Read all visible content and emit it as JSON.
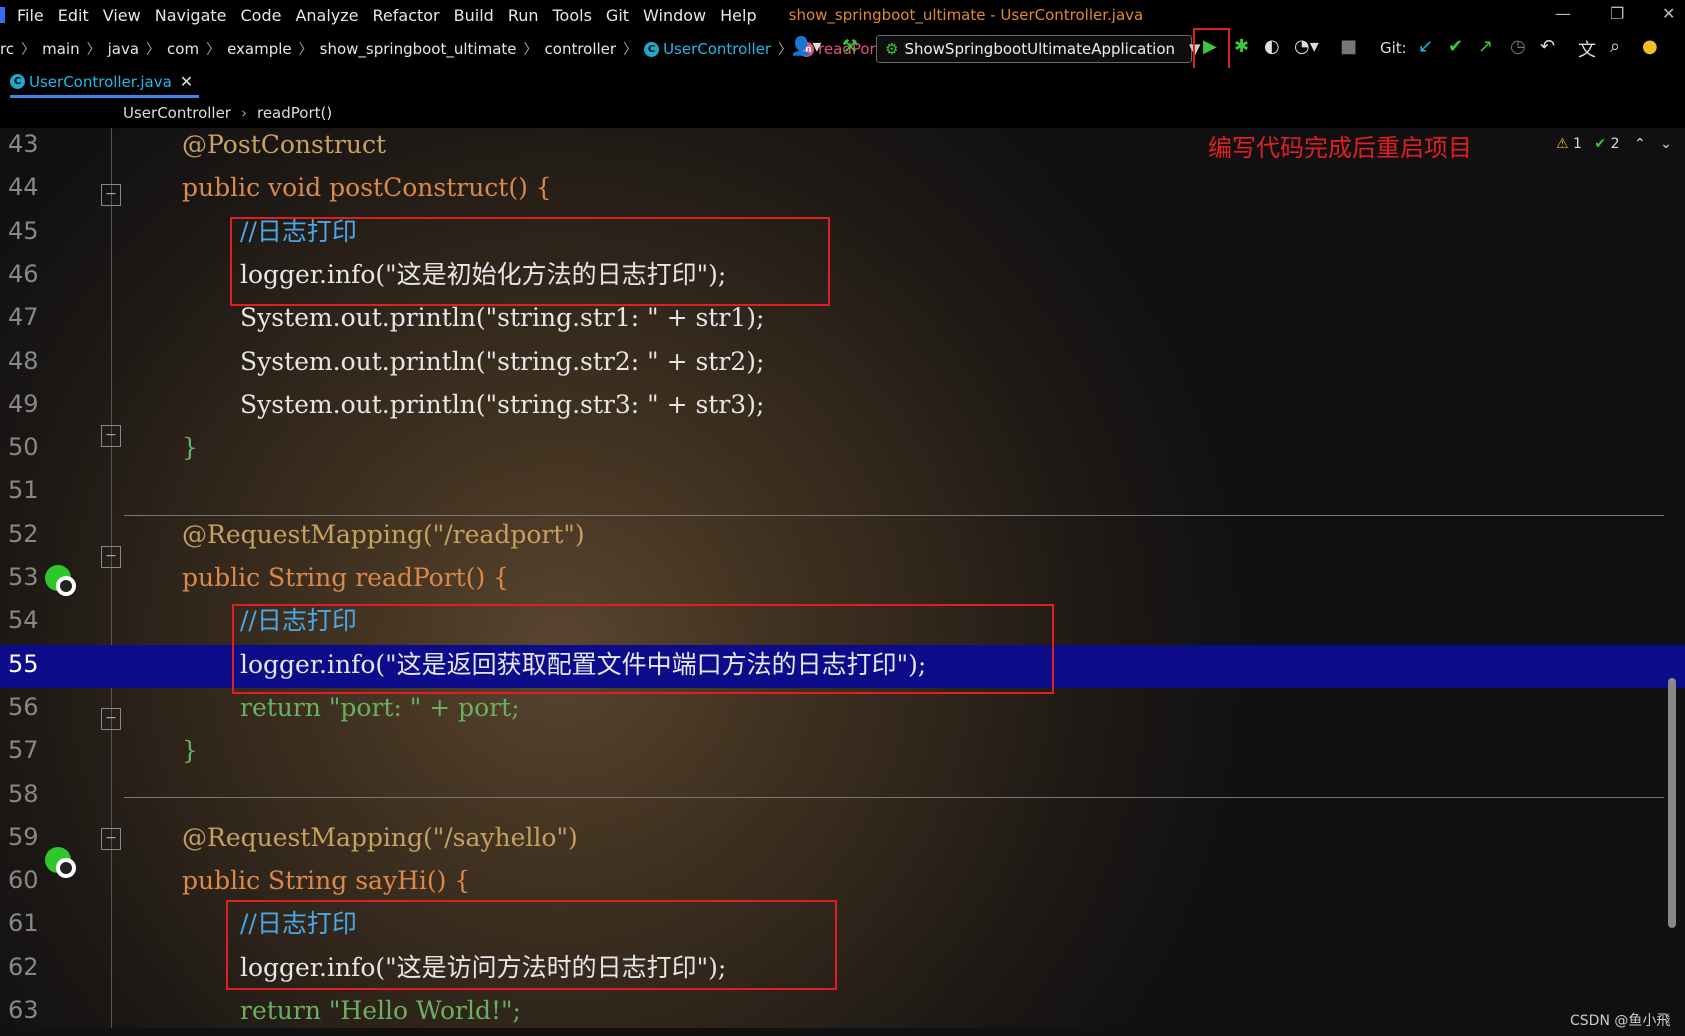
{
  "menubar": {
    "items": [
      "File",
      "Edit",
      "View",
      "Navigate",
      "Code",
      "Analyze",
      "Refactor",
      "Build",
      "Run",
      "Tools",
      "Git",
      "Window",
      "Help"
    ],
    "title": "show_springboot_ultimate - UserController.java"
  },
  "navbar": {
    "breadcrumbs": [
      "rc",
      "main",
      "java",
      "com",
      "example",
      "show_springboot_ultimate",
      "controller",
      "UserController",
      "readPort"
    ],
    "run_config": "ShowSpringbootUltimateApplication",
    "git_label": "Git:"
  },
  "tab": {
    "label": "UserController.java",
    "close": "✕"
  },
  "structure_crumbs": [
    "UserController",
    "readPort()"
  ],
  "inspections": {
    "warnings": "1",
    "ok": "2"
  },
  "annotation_note": "编写代码完成后重启项目",
  "lines": [
    {
      "n": "43",
      "text": "@PostConstruct"
    },
    {
      "n": "44",
      "text": "public void postConstruct() {"
    },
    {
      "n": "45",
      "text": "//日志打印"
    },
    {
      "n": "46",
      "text": "logger.info(\"这是初始化方法的日志打印\");"
    },
    {
      "n": "47",
      "text": "System.out.println(\"string.str1: \" + str1);"
    },
    {
      "n": "48",
      "text": "System.out.println(\"string.str2: \" + str2);"
    },
    {
      "n": "49",
      "text": "System.out.println(\"string.str3: \" + str3);"
    },
    {
      "n": "50",
      "text": "}"
    },
    {
      "n": "51",
      "text": ""
    },
    {
      "n": "52",
      "text": "@RequestMapping(\"/readport\")"
    },
    {
      "n": "53",
      "text": "public String readPort() {"
    },
    {
      "n": "54",
      "text": "//日志打印"
    },
    {
      "n": "55",
      "text": "logger.info(\"这是返回获取配置文件中端口方法的日志打印\");"
    },
    {
      "n": "56",
      "text": "return \"port: \" + port;"
    },
    {
      "n": "57",
      "text": "}"
    },
    {
      "n": "58",
      "text": ""
    },
    {
      "n": "59",
      "text": "@RequestMapping(\"/sayhello\")"
    },
    {
      "n": "60",
      "text": "public String sayHi() {"
    },
    {
      "n": "61",
      "text": "//日志打印"
    },
    {
      "n": "62",
      "text": "logger.info(\"这是访问方法时的日志打印\");"
    },
    {
      "n": "63",
      "text": "return \"Hello World!\";"
    }
  ],
  "watermark": "CSDN @鱼小飛",
  "colors": {
    "highlight_box": "#e02020",
    "current_line": "#0c0c8a"
  }
}
